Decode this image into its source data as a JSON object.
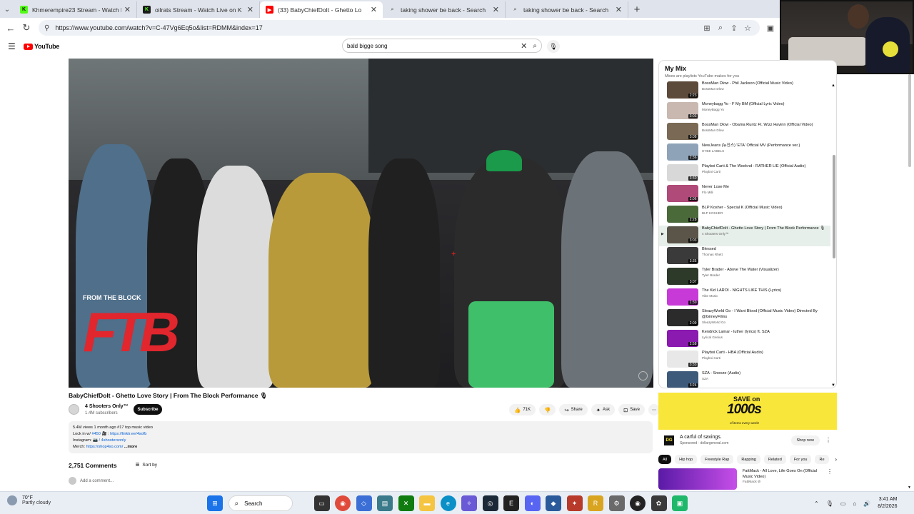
{
  "browser": {
    "tabs": [
      {
        "title": "Khmerempire23 Stream - Watch Li",
        "favicon": "kick-icon",
        "color": "#53fc18",
        "active": false
      },
      {
        "title": "oilrats Stream - Watch Live on K",
        "favicon": "kick-icon",
        "color": "#1a1a1a",
        "active": false
      },
      {
        "title": "(33) BabyChiefDoIt - Ghetto Lo",
        "favicon": "youtube-icon",
        "color": "#ff0000",
        "active": true
      },
      {
        "title": "taking shower be back - Search",
        "favicon": "search-icon",
        "color": "#9aa0a6",
        "active": false
      },
      {
        "title": "taking shower be back - Search",
        "favicon": "search-icon",
        "color": "#9aa0a6",
        "active": false
      }
    ],
    "url": "https://www.youtube.com/watch?v=C-47Vg6Eq5o&list=RDMM&index=17"
  },
  "youtube": {
    "logo_text": "YouTube",
    "search_query": "bald bigge song"
  },
  "video": {
    "title": "BabyChiefDoIt - Ghetto Love Story | From The Block Performance 🎙",
    "overlay_tag": "FROM THE BLOCK",
    "overlay_logo": "FTB",
    "channel": "4 Shooters Only™",
    "subscribers": "1.4M subscribers",
    "subscribe_label": "Subscribe",
    "likes": "71K",
    "share_label": "Share",
    "ask_label": "Ask",
    "save_label": "Save",
    "description": {
      "stats": "5.4M views  1 month ago  #17 top music video",
      "line2_prefix": "Lock in w/ ",
      "line2_tag": "#450",
      "line2_sep": " 🎥 : ",
      "line2_link": "https://linktr.ee/4sofb",
      "line3_prefix": "Instagram: ",
      "line3_link": "📷 / 4shootersonly",
      "line4_prefix": "Merch: ",
      "line4_link": "https://shop4so.com/",
      "more": "...more"
    },
    "comments_count": "2,751 Comments",
    "sort_label": "Sort by",
    "add_comment": "Add a comment..."
  },
  "playlist": {
    "title": "My Mix",
    "subtitle": "Mixes are playlists YouTube makes for you",
    "items": [
      {
        "title": "BossMan Dlow - Phil Jackson (Official Music Video)",
        "channel": "BossMan Dlow",
        "duration": "2:23",
        "color": "#5c4a3a"
      },
      {
        "title": "Moneybagg Yo - F My BM (Official Lyric Video)",
        "channel": "MoneyBagg Yo",
        "duration": "3:03",
        "color": "#c9b8b0"
      },
      {
        "title": "BossMan Dlow - Obama Runtz Ft. Wizz Havinn (Official Video)",
        "channel": "BossMan Dlow",
        "duration": "3:08",
        "color": "#7a6a55"
      },
      {
        "title": "NewJeans (뉴진스) 'ETA' Official MV (Performance ver.)",
        "channel": "HYBE LABELS",
        "duration": "2:36",
        "color": "#8fa3b8"
      },
      {
        "title": "Playboi Carti & The Weeknd - RATHER LIE (Official Audio)",
        "channel": "Playboi Carti",
        "duration": "3:30",
        "color": "#d8d8d8"
      },
      {
        "title": "Never Lose Me",
        "channel": "Flo Milli",
        "duration": "2:06",
        "color": "#b04a78"
      },
      {
        "title": "BLP Kosher - Special K (Official Music Video)",
        "channel": "BLP KOSHER",
        "duration": "2:28",
        "color": "#4a6a3a"
      },
      {
        "title": "BabyChiefDoIt - Ghetto Love Story | From The Block Performance 🎙",
        "channel": "4 Shooters Only™",
        "duration": "3:03",
        "color": "#5a5548",
        "current": true
      },
      {
        "title": "Blessed",
        "channel": "Thomas Rhett",
        "duration": "3:35",
        "color": "#3a3a3a"
      },
      {
        "title": "Tyler Brader - Above The Water (Visualizer)",
        "channel": "Tyler Brader",
        "duration": "3:07",
        "color": "#2d3a2a"
      },
      {
        "title": "The Kid LAROI - NIGHTS LIKE THIS (Lyrics)",
        "channel": "Vibe Music",
        "duration": "1:30",
        "color": "#c83ad8"
      },
      {
        "title": "SleazyWorld Go - I Want Blood (Official Music Video) Directed By @GimeyFilms",
        "channel": "SleazyWorld Go",
        "duration": "2:09",
        "color": "#2b2b2b"
      },
      {
        "title": "Kendrick Lamar - luther (lyrics) ft. SZA",
        "channel": "Lyrical Genius",
        "duration": "2:58",
        "color": "#8a1ab0"
      },
      {
        "title": "Playboi Carti - HBA (Official Audio)",
        "channel": "Playboi Carti",
        "duration": "3:33",
        "color": "#e8e8e8"
      },
      {
        "title": "SZA - Snooze (Audio)",
        "channel": "SZA",
        "duration": "3:24",
        "color": "#3d5a7a"
      }
    ]
  },
  "ad": {
    "line1": "SAVE on",
    "line2": "1000s",
    "line3": "of items every week!",
    "logo": "DG",
    "headline": "A carful of savings.",
    "sponsor": "Sponsored · dollargeneral.com",
    "cta": "Shop now"
  },
  "chips": [
    "All",
    "Hip hop",
    "Freestyle Rap",
    "Rapping",
    "Related",
    "For you",
    "Re"
  ],
  "recommendation": {
    "title": "FattMack - All Love, Life Goes On (Official Music Video)",
    "channel": "FattMack ⊘"
  },
  "taskbar": {
    "temperature": "70°F",
    "condition": "Partly cloudy",
    "search_label": "Search",
    "time": "3:41 AM",
    "date": "8/2/2026"
  }
}
